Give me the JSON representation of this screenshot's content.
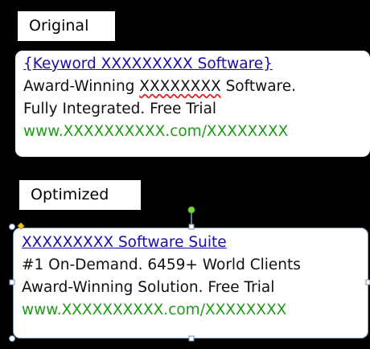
{
  "original": {
    "label": "Original",
    "headline": "{Keyword XXXXXXXXX Software}",
    "desc1_a": "Award-Winning ",
    "desc1_b": "XXXXXXXX",
    "desc1_c": " Software.",
    "desc2": "Fully Integrated. Free Trial",
    "url": "www.XXXXXXXXXX.com/XXXXXXXX"
  },
  "optimized": {
    "label": "Optimized",
    "headline": "XXXXXXXXX Software Suite",
    "desc1": "#1 On-Demand. 6459+ World Clients",
    "desc2": "Award-Winning Solution. Free Trial",
    "url": "www.XXXXXXXXXX.com/XXXXXXXX"
  },
  "colors": {
    "background": "#000000",
    "headline": "#1a0dab",
    "url": "#1f9a17",
    "text": "#111111",
    "spellcheck": "#e02020",
    "selection_border": "#7f9fc7",
    "rotate_handle": "#7cd63b",
    "adjust_handle": "#f2c21b"
  }
}
